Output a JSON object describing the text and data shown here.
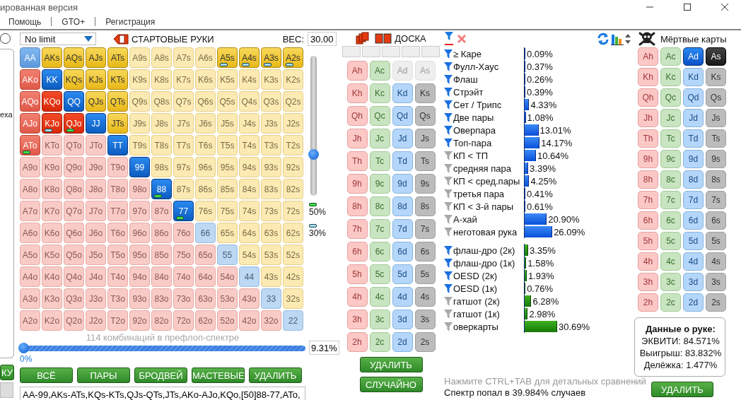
{
  "window": {
    "title": "ированная версия"
  },
  "menu": [
    "Помощь",
    "GTO+",
    "Регистрация"
  ],
  "left_panel": {
    "radio_selected": false,
    "text": "exa",
    "button": "КУ"
  },
  "range": {
    "game": "No limit",
    "title": "СТАРТОВЫЕ РУКИ",
    "weight_label": "ВЕС:",
    "weight_value": "30.00",
    "weight_slider": {
      "level": 0.3
    },
    "legend": [
      {
        "color": "#3ee040",
        "label": "50%"
      },
      {
        "color": "#a8d8ff",
        "label": "30%"
      }
    ],
    "matrix": [
      [
        {
          "label": "AA",
          "selected": true,
          "partial": true
        },
        {
          "label": "AKs",
          "selected": true
        },
        {
          "label": "AQs",
          "selected": true
        },
        {
          "label": "AJs",
          "selected": true
        },
        {
          "label": "ATs",
          "selected": true
        },
        {
          "label": "A9s",
          "selected": false
        },
        {
          "label": "A8s",
          "selected": false
        },
        {
          "label": "A7s",
          "selected": false
        },
        {
          "label": "A6s",
          "selected": false
        },
        {
          "label": "A5s",
          "selected": true,
          "color": "#a8d8ff"
        },
        {
          "label": "A4s",
          "selected": true,
          "color": "#a8d8ff"
        },
        {
          "label": "A3s",
          "selected": true,
          "color": "#a8d8ff"
        },
        {
          "label": "A2s",
          "selected": true,
          "color": "#a8d8ff"
        }
      ],
      [
        {
          "label": "AKo",
          "selected": true,
          "partial": true
        },
        {
          "label": "KK",
          "selected": true
        },
        {
          "label": "KQs",
          "selected": true
        },
        {
          "label": "KJs",
          "selected": true
        },
        {
          "label": "KTs",
          "selected": true
        },
        {
          "label": "K9s",
          "selected": false
        },
        {
          "label": "K8s",
          "selected": false
        },
        {
          "label": "K7s",
          "selected": false
        },
        {
          "label": "K6s",
          "selected": false
        },
        {
          "label": "K5s",
          "selected": false
        },
        {
          "label": "K4s",
          "selected": false
        },
        {
          "label": "K3s",
          "selected": false
        },
        {
          "label": "K2s",
          "selected": false
        }
      ],
      [
        {
          "label": "AQo",
          "selected": true,
          "partial": true
        },
        {
          "label": "KQo",
          "selected": true
        },
        {
          "label": "QQ",
          "selected": true
        },
        {
          "label": "QJs",
          "selected": true
        },
        {
          "label": "QTs",
          "selected": true
        },
        {
          "label": "Q9s",
          "selected": false
        },
        {
          "label": "Q8s",
          "selected": false
        },
        {
          "label": "Q7s",
          "selected": false
        },
        {
          "label": "Q6s",
          "selected": false
        },
        {
          "label": "Q5s",
          "selected": false
        },
        {
          "label": "Q4s",
          "selected": false
        },
        {
          "label": "Q3s",
          "selected": false
        },
        {
          "label": "Q2s",
          "selected": false
        }
      ],
      [
        {
          "label": "AJo",
          "selected": true,
          "partial": true
        },
        {
          "label": "KJo",
          "selected": true,
          "color": "#a8d8ff"
        },
        {
          "label": "QJo",
          "selected": true,
          "color": "#3ee040"
        },
        {
          "label": "JJ",
          "selected": true
        },
        {
          "label": "JTs",
          "selected": true
        },
        {
          "label": "J9s",
          "selected": false
        },
        {
          "label": "J8s",
          "selected": false
        },
        {
          "label": "J7s",
          "selected": false
        },
        {
          "label": "J6s",
          "selected": false
        },
        {
          "label": "J5s",
          "selected": false
        },
        {
          "label": "J4s",
          "selected": false
        },
        {
          "label": "J3s",
          "selected": false
        },
        {
          "label": "J2s",
          "selected": false
        }
      ],
      [
        {
          "label": "ATo",
          "selected": true,
          "partial": true,
          "color": "#3ee040"
        },
        {
          "label": "KTo",
          "selected": false
        },
        {
          "label": "QTo",
          "selected": false
        },
        {
          "label": "JTo",
          "selected": false
        },
        {
          "label": "TT",
          "selected": true
        },
        {
          "label": "T9s",
          "selected": false
        },
        {
          "label": "T8s",
          "selected": false
        },
        {
          "label": "T7s",
          "selected": false
        },
        {
          "label": "T6s",
          "selected": false
        },
        {
          "label": "T5s",
          "selected": false
        },
        {
          "label": "T4s",
          "selected": false
        },
        {
          "label": "T3s",
          "selected": false
        },
        {
          "label": "T2s",
          "selected": false
        }
      ],
      [
        {
          "label": "A9o",
          "selected": false
        },
        {
          "label": "K9o",
          "selected": false
        },
        {
          "label": "Q9o",
          "selected": false
        },
        {
          "label": "J9o",
          "selected": false
        },
        {
          "label": "T9o",
          "selected": false
        },
        {
          "label": "99",
          "selected": true
        },
        {
          "label": "98s",
          "selected": false
        },
        {
          "label": "97s",
          "selected": false
        },
        {
          "label": "96s",
          "selected": false
        },
        {
          "label": "95s",
          "selected": false
        },
        {
          "label": "94s",
          "selected": false
        },
        {
          "label": "93s",
          "selected": false
        },
        {
          "label": "92s",
          "selected": false
        }
      ],
      [
        {
          "label": "A8o",
          "selected": false
        },
        {
          "label": "K8o",
          "selected": false
        },
        {
          "label": "Q8o",
          "selected": false
        },
        {
          "label": "J8o",
          "selected": false
        },
        {
          "label": "T8o",
          "selected": false
        },
        {
          "label": "98o",
          "selected": false
        },
        {
          "label": "88",
          "selected": true,
          "color": "#3ee040"
        },
        {
          "label": "87s",
          "selected": false
        },
        {
          "label": "86s",
          "selected": false
        },
        {
          "label": "85s",
          "selected": false
        },
        {
          "label": "84s",
          "selected": false
        },
        {
          "label": "83s",
          "selected": false
        },
        {
          "label": "82s",
          "selected": false
        }
      ],
      [
        {
          "label": "A7o",
          "selected": false
        },
        {
          "label": "K7o",
          "selected": false
        },
        {
          "label": "Q7o",
          "selected": false
        },
        {
          "label": "J7o",
          "selected": false
        },
        {
          "label": "T7o",
          "selected": false
        },
        {
          "label": "97o",
          "selected": false
        },
        {
          "label": "87o",
          "selected": false
        },
        {
          "label": "77",
          "selected": true,
          "color": "#3ee040"
        },
        {
          "label": "76s",
          "selected": false
        },
        {
          "label": "75s",
          "selected": false
        },
        {
          "label": "74s",
          "selected": false
        },
        {
          "label": "73s",
          "selected": false
        },
        {
          "label": "72s",
          "selected": false
        }
      ],
      [
        {
          "label": "A6o",
          "selected": false
        },
        {
          "label": "K6o",
          "selected": false
        },
        {
          "label": "Q6o",
          "selected": false
        },
        {
          "label": "J6o",
          "selected": false
        },
        {
          "label": "T6o",
          "selected": false
        },
        {
          "label": "96o",
          "selected": false
        },
        {
          "label": "86o",
          "selected": false
        },
        {
          "label": "76o",
          "selected": false
        },
        {
          "label": "66",
          "selected": false
        },
        {
          "label": "65s",
          "selected": false
        },
        {
          "label": "64s",
          "selected": false
        },
        {
          "label": "63s",
          "selected": false
        },
        {
          "label": "62s",
          "selected": false
        }
      ],
      [
        {
          "label": "A5o",
          "selected": false
        },
        {
          "label": "K5o",
          "selected": false
        },
        {
          "label": "Q5o",
          "selected": false
        },
        {
          "label": "J5o",
          "selected": false
        },
        {
          "label": "T5o",
          "selected": false
        },
        {
          "label": "95o",
          "selected": false
        },
        {
          "label": "85o",
          "selected": false
        },
        {
          "label": "75o",
          "selected": false
        },
        {
          "label": "65o",
          "selected": false
        },
        {
          "label": "55",
          "selected": false
        },
        {
          "label": "54s",
          "selected": false
        },
        {
          "label": "53s",
          "selected": false
        },
        {
          "label": "52s",
          "selected": false
        }
      ],
      [
        {
          "label": "A4o",
          "selected": false
        },
        {
          "label": "K4o",
          "selected": false
        },
        {
          "label": "Q4o",
          "selected": false
        },
        {
          "label": "J4o",
          "selected": false
        },
        {
          "label": "T4o",
          "selected": false
        },
        {
          "label": "94o",
          "selected": false
        },
        {
          "label": "84o",
          "selected": false
        },
        {
          "label": "74o",
          "selected": false
        },
        {
          "label": "64o",
          "selected": false
        },
        {
          "label": "54o",
          "selected": false
        },
        {
          "label": "44",
          "selected": false
        },
        {
          "label": "43s",
          "selected": false
        },
        {
          "label": "42s",
          "selected": false
        }
      ],
      [
        {
          "label": "A3o",
          "selected": false
        },
        {
          "label": "K3o",
          "selected": false
        },
        {
          "label": "Q3o",
          "selected": false
        },
        {
          "label": "J3o",
          "selected": false
        },
        {
          "label": "T3o",
          "selected": false
        },
        {
          "label": "93o",
          "selected": false
        },
        {
          "label": "83o",
          "selected": false
        },
        {
          "label": "73o",
          "selected": false
        },
        {
          "label": "63o",
          "selected": false
        },
        {
          "label": "53o",
          "selected": false
        },
        {
          "label": "43o",
          "selected": false
        },
        {
          "label": "33",
          "selected": false
        },
        {
          "label": "32s",
          "selected": false
        }
      ],
      [
        {
          "label": "A2o",
          "selected": false
        },
        {
          "label": "K2o",
          "selected": false
        },
        {
          "label": "Q2o",
          "selected": false
        },
        {
          "label": "J2o",
          "selected": false
        },
        {
          "label": "T2o",
          "selected": false
        },
        {
          "label": "92o",
          "selected": false
        },
        {
          "label": "82o",
          "selected": false
        },
        {
          "label": "72o",
          "selected": false
        },
        {
          "label": "62o",
          "selected": false
        },
        {
          "label": "52o",
          "selected": false
        },
        {
          "label": "42o",
          "selected": false
        },
        {
          "label": "32o",
          "selected": false
        },
        {
          "label": "22",
          "selected": false
        }
      ]
    ],
    "combos_caption": "114 комбинаций в префлоп-спектре",
    "range_slider": {
      "level": 0
    },
    "range_slider_label": "0%",
    "range_percent": "9.31%",
    "buttons": [
      "ВСЁ",
      "ПАРЫ",
      "БРОДВЕЙ",
      "МАСТЕВЫЕ",
      "УДАЛИТЬ"
    ],
    "range_text": "AA-99,AKs-ATs,KQs-KTs,QJs-QTs,JTs,AKo-AJo,KQo,[50]88-77,ATo,"
  },
  "board": {
    "title": "ДОСКА",
    "cards": [
      [
        {
          "label": "Ah",
          "disabled": false
        },
        {
          "label": "Ac",
          "disabled": false
        },
        {
          "label": "Ad",
          "disabled": true
        },
        {
          "label": "As",
          "disabled": true
        }
      ],
      [
        {
          "label": "Kh",
          "disabled": false
        },
        {
          "label": "Kc",
          "disabled": false
        },
        {
          "label": "Kd",
          "disabled": false
        },
        {
          "label": "Ks",
          "disabled": false
        }
      ],
      [
        {
          "label": "Qh",
          "disabled": false
        },
        {
          "label": "Qc",
          "disabled": false
        },
        {
          "label": "Qd",
          "disabled": false
        },
        {
          "label": "Qs",
          "disabled": false
        }
      ],
      [
        {
          "label": "Jh",
          "disabled": false
        },
        {
          "label": "Jc",
          "disabled": false
        },
        {
          "label": "Jd",
          "disabled": false
        },
        {
          "label": "Js",
          "disabled": false
        }
      ],
      [
        {
          "label": "Th",
          "disabled": false
        },
        {
          "label": "Tc",
          "disabled": false
        },
        {
          "label": "Td",
          "disabled": false
        },
        {
          "label": "Ts",
          "disabled": false
        }
      ],
      [
        {
          "label": "9h",
          "disabled": false
        },
        {
          "label": "9c",
          "disabled": false
        },
        {
          "label": "9d",
          "disabled": false
        },
        {
          "label": "9s",
          "disabled": false
        }
      ],
      [
        {
          "label": "8h",
          "disabled": false
        },
        {
          "label": "8c",
          "disabled": false
        },
        {
          "label": "8d",
          "disabled": false
        },
        {
          "label": "8s",
          "disabled": false
        }
      ],
      [
        {
          "label": "7h",
          "disabled": false
        },
        {
          "label": "7c",
          "disabled": false
        },
        {
          "label": "7d",
          "disabled": false
        },
        {
          "label": "7s",
          "disabled": false
        }
      ],
      [
        {
          "label": "6h",
          "disabled": false
        },
        {
          "label": "6c",
          "disabled": false
        },
        {
          "label": "6d",
          "disabled": false
        },
        {
          "label": "6s",
          "disabled": false
        }
      ],
      [
        {
          "label": "5h",
          "disabled": false
        },
        {
          "label": "5c",
          "disabled": false
        },
        {
          "label": "5d",
          "disabled": false
        },
        {
          "label": "5s",
          "disabled": false
        }
      ],
      [
        {
          "label": "4h",
          "disabled": false
        },
        {
          "label": "4c",
          "disabled": false
        },
        {
          "label": "4d",
          "disabled": false
        },
        {
          "label": "4s",
          "disabled": false
        }
      ],
      [
        {
          "label": "3h",
          "disabled": false
        },
        {
          "label": "3c",
          "disabled": false
        },
        {
          "label": "3d",
          "disabled": false
        },
        {
          "label": "3s",
          "disabled": false
        }
      ],
      [
        {
          "label": "2h",
          "disabled": false
        },
        {
          "label": "2c",
          "disabled": false
        },
        {
          "label": "2d",
          "disabled": false
        },
        {
          "label": "2s",
          "disabled": false
        }
      ]
    ],
    "buttons": [
      "УДАЛИТЬ",
      "СЛУЧАЙНО"
    ]
  },
  "stats": {
    "made_hands": [
      {
        "label": "≥ Каре",
        "filter": true,
        "value": "0.09%",
        "level": 0.0009
      },
      {
        "label": "Фулл-Хаус",
        "filter": true,
        "value": "0.37%",
        "level": 0.0037
      },
      {
        "label": "Флаш",
        "filter": true,
        "value": "0.26%",
        "level": 0.0026
      },
      {
        "label": "Стрэйт",
        "filter": true,
        "value": "0.39%",
        "level": 0.0039
      },
      {
        "label": "Сет / Трипс",
        "filter": true,
        "value": "4.33%",
        "level": 0.0433
      },
      {
        "label": "Две пары",
        "filter": true,
        "value": "1.08%",
        "level": 0.0108
      },
      {
        "label": "Оверпара",
        "filter": true,
        "value": "13.01%",
        "level": 0.1301
      },
      {
        "label": "Топ-пара",
        "filter": true,
        "value": "14.17%",
        "level": 0.1417
      },
      {
        "label": "КП < ТП",
        "filter": false,
        "value": "10.64%",
        "level": 0.1064
      },
      {
        "label": "средняя пара",
        "filter": false,
        "value": "3.39%",
        "level": 0.0339
      },
      {
        "label": "КП < сред.пары",
        "filter": false,
        "value": "4.25%",
        "level": 0.0425
      },
      {
        "label": "третья пара",
        "filter": false,
        "value": "0.41%",
        "level": 0.0041
      },
      {
        "label": "КП < 3-й пары",
        "filter": false,
        "value": "0.61%",
        "level": 0.0061
      },
      {
        "label": "А-хай",
        "filter": false,
        "value": "20.90%",
        "level": 0.209
      },
      {
        "label": "неготовая рука",
        "filter": false,
        "value": "26.09%",
        "level": 0.2609
      }
    ],
    "draws": [
      {
        "label": "флаш-дро (2к)",
        "filter": true,
        "value": "3.35%",
        "level": 0.0335
      },
      {
        "label": "флаш-дро (1к)",
        "filter": true,
        "value": "1.58%",
        "level": 0.0158
      },
      {
        "label": "OESD (2к)",
        "filter": true,
        "value": "1.93%",
        "level": 0.0193
      },
      {
        "label": "OESD (1к)",
        "filter": true,
        "value": "0.76%",
        "level": 0.0076
      },
      {
        "label": "гатшот (2к)",
        "filter": false,
        "value": "6.28%",
        "level": 0.0628
      },
      {
        "label": "гатшот (1к)",
        "filter": false,
        "value": "2.98%",
        "level": 0.0298
      },
      {
        "label": "оверкарты",
        "filter": false,
        "value": "30.69%",
        "level": 0.3069
      }
    ],
    "hint": "Нажмите CTRL+TAB для детальных сравнений",
    "hit_rate": "Спектр попал в 39.984% случаев"
  },
  "dead_cards": {
    "title": "Мёртвые карты",
    "cards": [
      [
        {
          "label": "Ah",
          "selected": false
        },
        {
          "label": "Ac",
          "selected": false
        },
        {
          "label": "Ad",
          "selected": true
        },
        {
          "label": "As",
          "selected": true
        }
      ],
      [
        {
          "label": "Kh",
          "selected": false
        },
        {
          "label": "Kc",
          "selected": false
        },
        {
          "label": "Kd",
          "selected": false
        },
        {
          "label": "Ks",
          "selected": false
        }
      ],
      [
        {
          "label": "Qh",
          "selected": false
        },
        {
          "label": "Qc",
          "selected": false
        },
        {
          "label": "Qd",
          "selected": false
        },
        {
          "label": "Qs",
          "selected": false
        }
      ],
      [
        {
          "label": "Jh",
          "selected": false
        },
        {
          "label": "Jc",
          "selected": false
        },
        {
          "label": "Jd",
          "selected": false
        },
        {
          "label": "Js",
          "selected": false
        }
      ],
      [
        {
          "label": "Th",
          "selected": false
        },
        {
          "label": "Tc",
          "selected": false
        },
        {
          "label": "Td",
          "selected": false
        },
        {
          "label": "Ts",
          "selected": false
        }
      ],
      [
        {
          "label": "9h",
          "selected": false
        },
        {
          "label": "9c",
          "selected": false
        },
        {
          "label": "9d",
          "selected": false
        },
        {
          "label": "9s",
          "selected": false
        }
      ],
      [
        {
          "label": "8h",
          "selected": false
        },
        {
          "label": "8c",
          "selected": false
        },
        {
          "label": "8d",
          "selected": false
        },
        {
          "label": "8s",
          "selected": false
        }
      ],
      [
        {
          "label": "7h",
          "selected": false
        },
        {
          "label": "7c",
          "selected": false
        },
        {
          "label": "7d",
          "selected": false
        },
        {
          "label": "7s",
          "selected": false
        }
      ],
      [
        {
          "label": "6h",
          "selected": false
        },
        {
          "label": "6c",
          "selected": false
        },
        {
          "label": "6d",
          "selected": false
        },
        {
          "label": "6s",
          "selected": false
        }
      ],
      [
        {
          "label": "5h",
          "selected": false
        },
        {
          "label": "5c",
          "selected": false
        },
        {
          "label": "5d",
          "selected": false
        },
        {
          "label": "5s",
          "selected": false
        }
      ],
      [
        {
          "label": "4h",
          "selected": false
        },
        {
          "label": "4c",
          "selected": false
        },
        {
          "label": "4d",
          "selected": false
        },
        {
          "label": "4s",
          "selected": false
        }
      ],
      [
        {
          "label": "3h",
          "selected": false
        },
        {
          "label": "3c",
          "selected": false
        },
        {
          "label": "3d",
          "selected": false
        },
        {
          "label": "3s",
          "selected": false
        }
      ],
      [
        {
          "label": "2h",
          "selected": false
        },
        {
          "label": "2c",
          "selected": false
        },
        {
          "label": "2d",
          "selected": false
        },
        {
          "label": "2s",
          "selected": false
        }
      ]
    ],
    "hand_data": {
      "title": "Данные о руке:",
      "lines": [
        "ЭКВИТИ: 84.571%",
        "Выигрыш: 83.832%",
        "Делёжка: 1.477%"
      ]
    },
    "button": "УДАЛИТЬ"
  }
}
